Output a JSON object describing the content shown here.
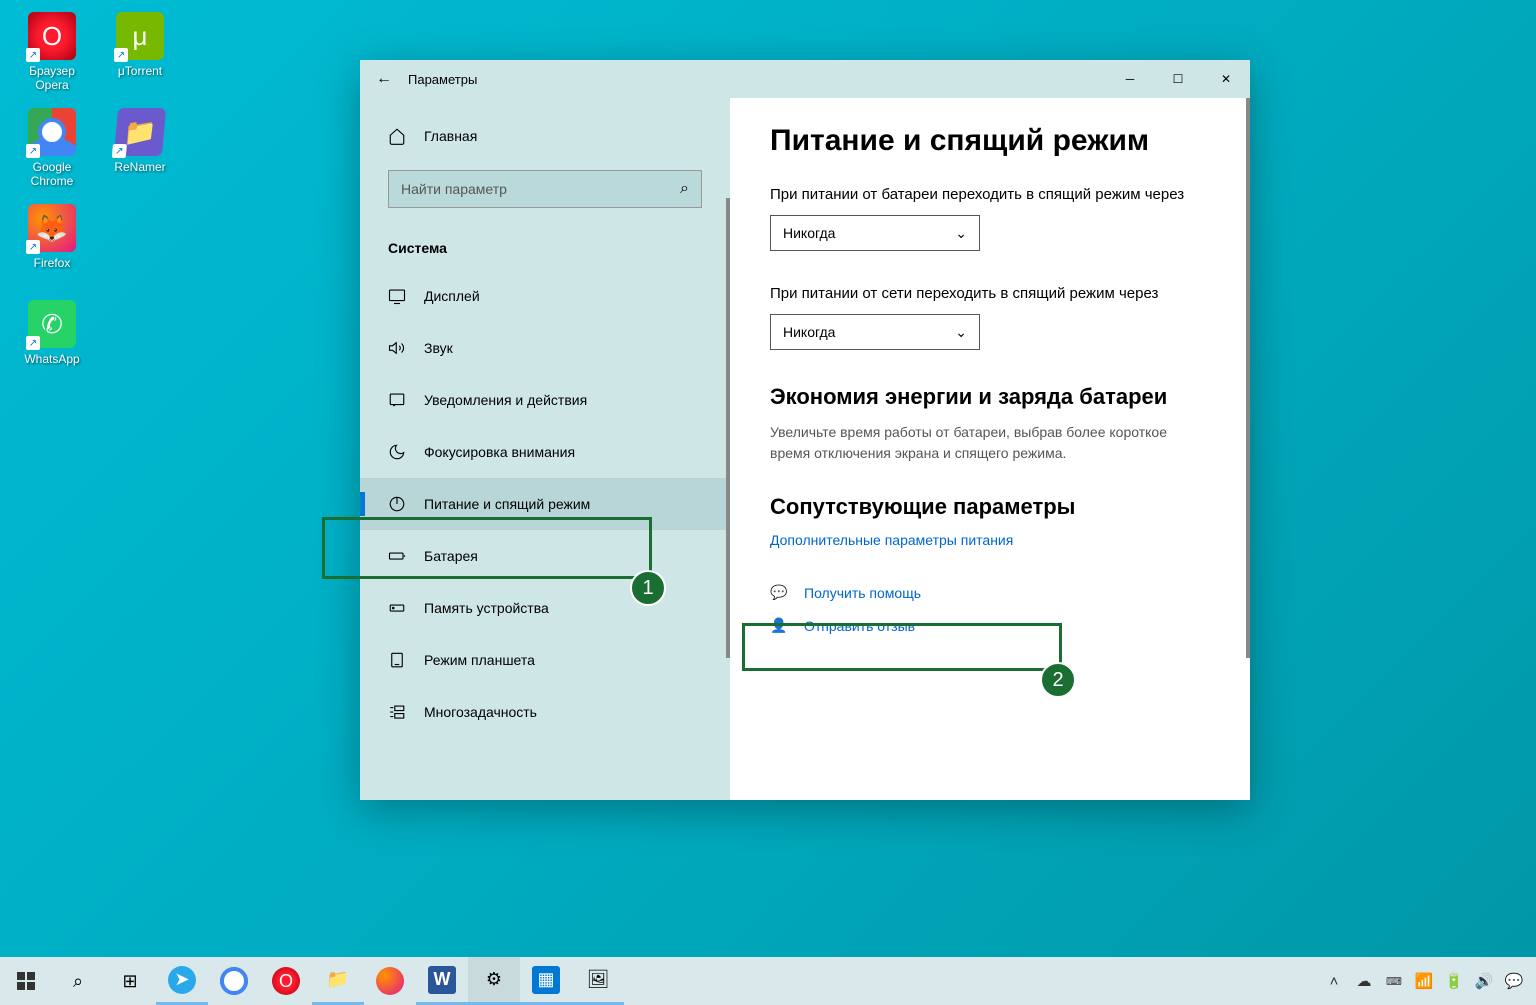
{
  "desktop_icons": [
    {
      "label": "Браузер Opera"
    },
    {
      "label": "μTorrent"
    },
    {
      "label": "Google Chrome"
    },
    {
      "label": "ReNamer"
    },
    {
      "label": "Firefox"
    },
    {
      "label": "WhatsApp"
    }
  ],
  "window": {
    "title": "Параметры",
    "home": "Главная",
    "search_placeholder": "Найти параметр",
    "section": "Система",
    "nav": [
      {
        "label": "Дисплей"
      },
      {
        "label": "Звук"
      },
      {
        "label": "Уведомления и действия"
      },
      {
        "label": "Фокусировка внимания"
      },
      {
        "label": "Питание и спящий режим"
      },
      {
        "label": "Батарея"
      },
      {
        "label": "Память устройства"
      },
      {
        "label": "Режим планшета"
      },
      {
        "label": "Многозадачность"
      }
    ]
  },
  "content": {
    "heading": "Питание и спящий режим",
    "battery_label": "При питании от батареи переходить в спящий режим через",
    "battery_value": "Никогда",
    "ac_label": "При питании от сети переходить в спящий режим через",
    "ac_value": "Никогда",
    "eco_heading": "Экономия энергии и заряда батареи",
    "eco_desc": "Увеличьте время работы от батареи, выбрав более короткое время отключения экрана и спящего режима.",
    "related_heading": "Сопутствующие параметры",
    "related_link": "Дополнительные параметры питания",
    "help_link": "Получить помощь",
    "feedback_link": "Отправить отзыв"
  },
  "highlights": {
    "one": "1",
    "two": "2"
  }
}
